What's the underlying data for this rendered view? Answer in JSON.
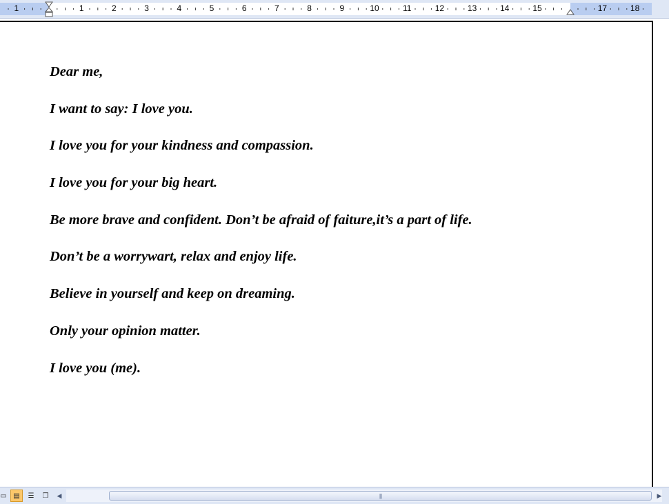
{
  "ruler": {
    "numbers": [
      "1",
      "1",
      "2",
      "3",
      "4",
      "5",
      "6",
      "7",
      "8",
      "9",
      "10",
      "11",
      "12",
      "13",
      "14",
      "15",
      "17",
      "18"
    ]
  },
  "document": {
    "lines": [
      "Dear me,",
      "I want to say: I love you.",
      "I love you for your kindness and compassion.",
      "I love you for your big heart.",
      "Be more brave and confident. Don’t be afraid of faiture,it’s a part of life.",
      "Don’t be a worrywart, relax and enjoy life.",
      "Believe in yourself and keep on dreaming.",
      "Only your opinion matter.",
      "I love you (me)."
    ]
  },
  "views": {
    "buttons": [
      {
        "icon": "normal-view-icon",
        "active": false
      },
      {
        "icon": "print-layout-view-icon",
        "active": true
      },
      {
        "icon": "outline-view-icon",
        "active": false
      },
      {
        "icon": "reading-view-icon",
        "active": false
      }
    ]
  },
  "colors": {
    "ruler_bg": "#dfe7f5",
    "ruler_margin": "#b9cdf0",
    "active_view": "#fcc76a"
  }
}
